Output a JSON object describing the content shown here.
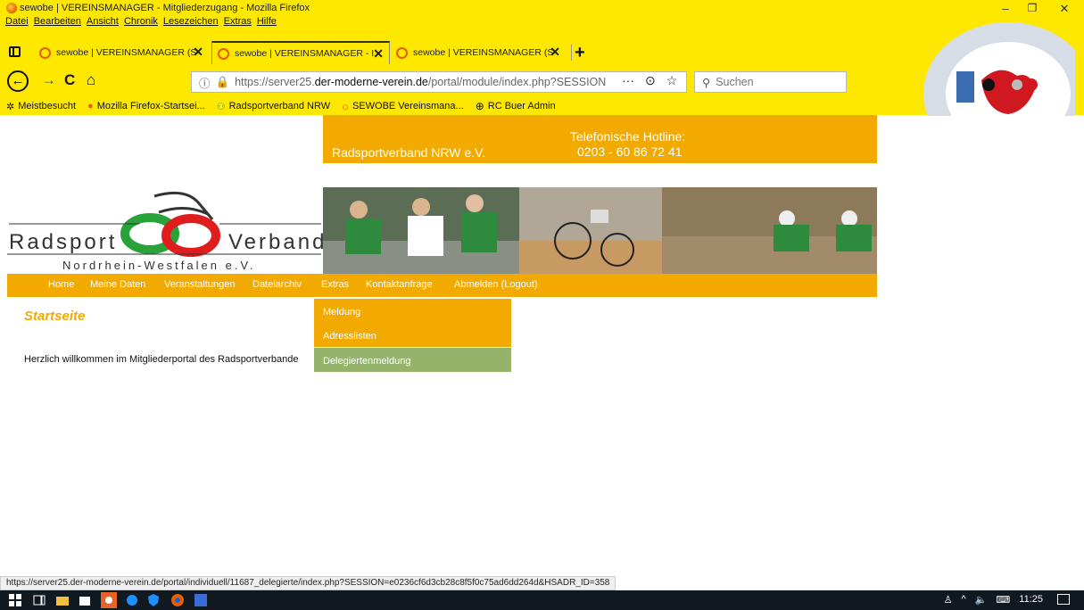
{
  "window": {
    "title": "sewobe | VEREINSMANAGER - Mitgliederzugang - Mozilla Firefox",
    "minimize": "–",
    "maximize": "❐",
    "close": "✕"
  },
  "menubar": [
    "Datei",
    "Bearbeiten",
    "Ansicht",
    "Chronik",
    "Lesezeichen",
    "Extras",
    "Hilfe"
  ],
  "tabs": [
    {
      "label": "sewobe | VEREINSMANAGER (S",
      "active": false
    },
    {
      "label": "sewobe | VEREINSMANAGER - I",
      "active": true
    },
    {
      "label": "sewobe | VEREINSMANAGER (S",
      "active": false
    }
  ],
  "tab_close": "✕",
  "new_tab": "+",
  "navbar": {
    "back": "←",
    "forward": "→",
    "reload": "C",
    "home": "⌂",
    "url_prefix": "https://server25.",
    "url_host": "der-moderne-verein.de",
    "url_path": "/portal/module/index.php?SESSION",
    "page_actions": "···",
    "search_placeholder": "Suchen"
  },
  "bookmarks": [
    {
      "icon": "gear-icon",
      "label": "Meistbesucht"
    },
    {
      "icon": "firefox-icon",
      "label": "Mozilla Firefox-Startsei..."
    },
    {
      "icon": "cyclist-icon",
      "label": "Radsportverband NRW"
    },
    {
      "icon": "ring-icon",
      "label": "SEWOBE Vereinsmana..."
    },
    {
      "icon": "globe-icon",
      "label": "RC Buer Admin"
    }
  ],
  "header": {
    "org_name": "Radsportverband NRW e.V.",
    "hotline_label": "Telefonische Hotline:",
    "hotline_number": "0203 - 60 86 72 41"
  },
  "logo": {
    "left_word": "Radsport",
    "right_word": "Verband",
    "subtitle": "Nordrhein-Westfalen e.V."
  },
  "mainnav": [
    "Home",
    "Meine Daten",
    "Veranstaltungen",
    "Dateiarchiv",
    "Extras",
    "Kontaktanfrage",
    "Abmelden (Logout)"
  ],
  "dropdown": [
    "Meldung",
    "Adresslisten",
    "Delegiertenmeldung"
  ],
  "main": {
    "title": "Startseite",
    "welcome": "Herzlich willkommen im Mitgliederportal des Radsportverbande"
  },
  "status_url": "https://server25.der-moderne-verein.de/portal/individuell/11687_delegierte/index.php?SESSION=e0236cf6d3cb28c8f5f0c75ad6dd264d&HSADR_ID=358",
  "taskbar": {
    "time": "11:25",
    "tray_people": "♙",
    "tray_arrow": "^",
    "tray_volume": "🔈",
    "tray_keyboard": "⌨"
  },
  "colors": {
    "browser_chrome": "#ffe800",
    "brand_orange": "#f2a900",
    "dropdown_hover": "#95b36a",
    "taskbar": "#101820"
  }
}
